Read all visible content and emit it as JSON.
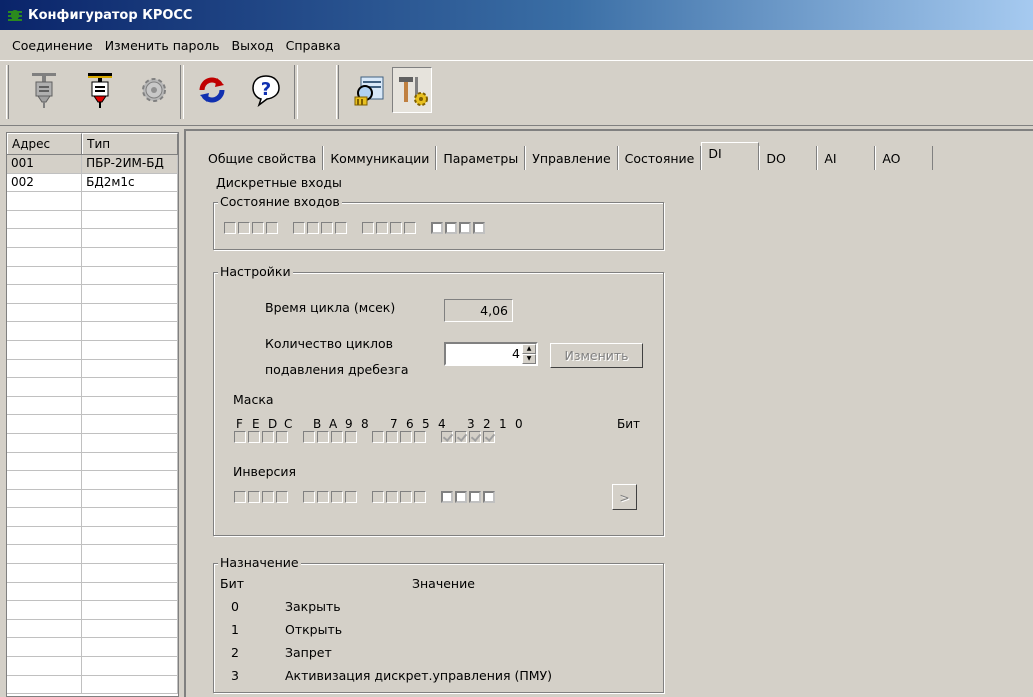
{
  "window": {
    "title": "Конфигуратор КРОСС"
  },
  "menu": [
    "Соединение",
    "Изменить пароль",
    "Выход",
    "Справка"
  ],
  "toolbar": {
    "buttons": [
      "connect-icon",
      "disconnect-icon",
      "settings-gear-icon",
      "refresh-icon",
      "help-icon",
      "search-device-icon",
      "tools-configure-icon"
    ]
  },
  "device_table": {
    "headers": [
      "Адрес",
      "Тип"
    ],
    "rows": [
      {
        "addr": "001",
        "type": "ПБР-2ИМ-БД"
      },
      {
        "addr": "002",
        "type": "БД2м1с"
      }
    ]
  },
  "tabs": [
    "Общие свойства",
    "Коммуникации",
    "Параметры",
    "Управление",
    "Состояние",
    "DI",
    "DO",
    "AI",
    "AO"
  ],
  "active_tab": "DI",
  "page": {
    "section_title": "Дискретные входы",
    "inputs_state": {
      "legend": "Состояние входов"
    },
    "settings": {
      "legend": "Настройки",
      "cycle_time_label": "Время цикла (мсек)",
      "cycle_time_value": "4,06",
      "debounce_label_1": "Количество циклов",
      "debounce_label_2": "подавления дребезга",
      "debounce_value": "4",
      "change_button": "Изменить",
      "mask_label": "Маска",
      "bits": [
        "F",
        "E",
        "D",
        "C",
        "B",
        "A",
        "9",
        "8",
        "7",
        "6",
        "5",
        "4",
        "3",
        "2",
        "1",
        "0"
      ],
      "bit_label": "Бит",
      "inversion_label": "Инверсия",
      "apply_arrow": ">"
    },
    "assignment": {
      "legend": "Назначение",
      "col_bit": "Бит",
      "col_value": "Значение",
      "rows": [
        {
          "bit": "0",
          "value": "Закрыть"
        },
        {
          "bit": "1",
          "value": "Открыть"
        },
        {
          "bit": "2",
          "value": "Запрет"
        },
        {
          "bit": "3",
          "value": "Активизация дискрет.управления (ПМУ)"
        }
      ]
    }
  }
}
